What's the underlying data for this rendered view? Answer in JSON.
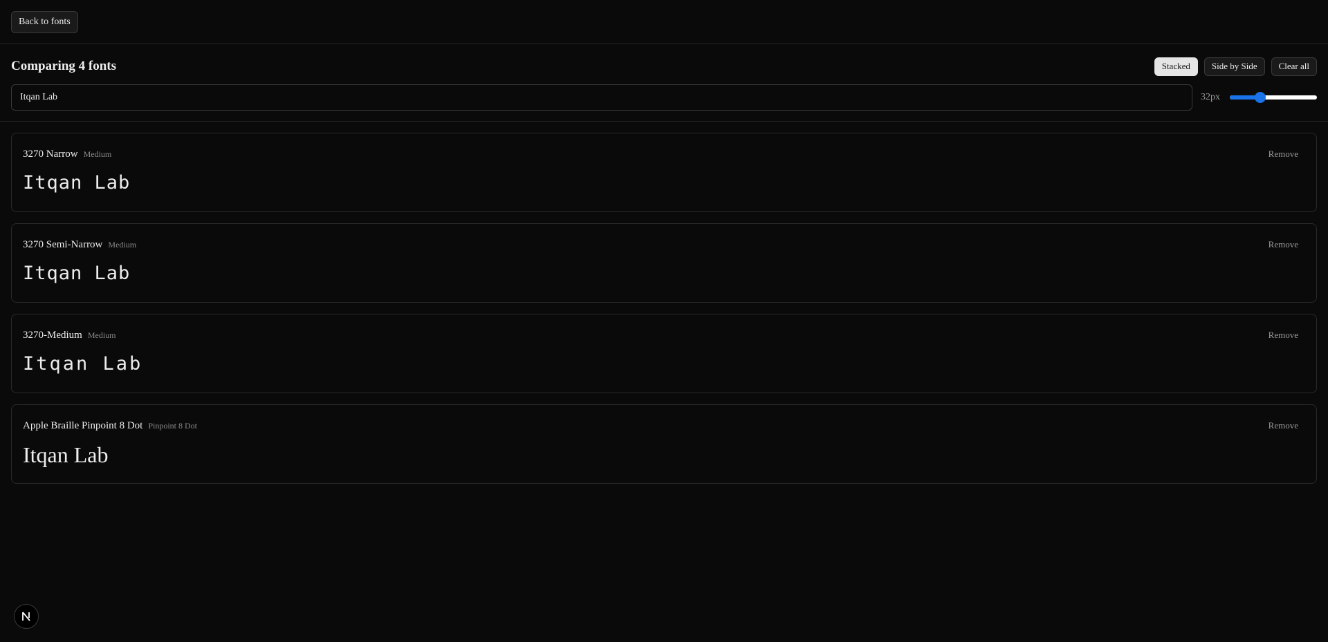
{
  "topbar": {
    "back_label": "Back to fonts"
  },
  "controls": {
    "title": "Comparing 4 fonts",
    "view_buttons": [
      "Stacked",
      "Side by Side",
      "Clear all"
    ],
    "active_view": "Stacked",
    "preview_text": "Itqan Lab",
    "size_label": "32px",
    "size_fraction": 0.35
  },
  "fonts": [
    {
      "name": "3270 Narrow",
      "style": "Medium",
      "sample": "Itqan Lab",
      "remove": "Remove"
    },
    {
      "name": "3270 Semi-Narrow",
      "style": "Medium",
      "sample": "Itqan Lab",
      "remove": "Remove"
    },
    {
      "name": "3270-Medium",
      "style": "Medium",
      "sample": "Itqan Lab",
      "remove": "Remove"
    },
    {
      "name": "Apple Braille Pinpoint 8 Dot",
      "style": "Pinpoint 8 Dot",
      "sample": "Itqan Lab",
      "remove": "Remove"
    }
  ],
  "icons": {
    "badge": "next-logo-icon"
  },
  "colors": {
    "background": "#0a0a0a",
    "accent": "#1a73e8",
    "active_button": "#e5e5e5"
  }
}
